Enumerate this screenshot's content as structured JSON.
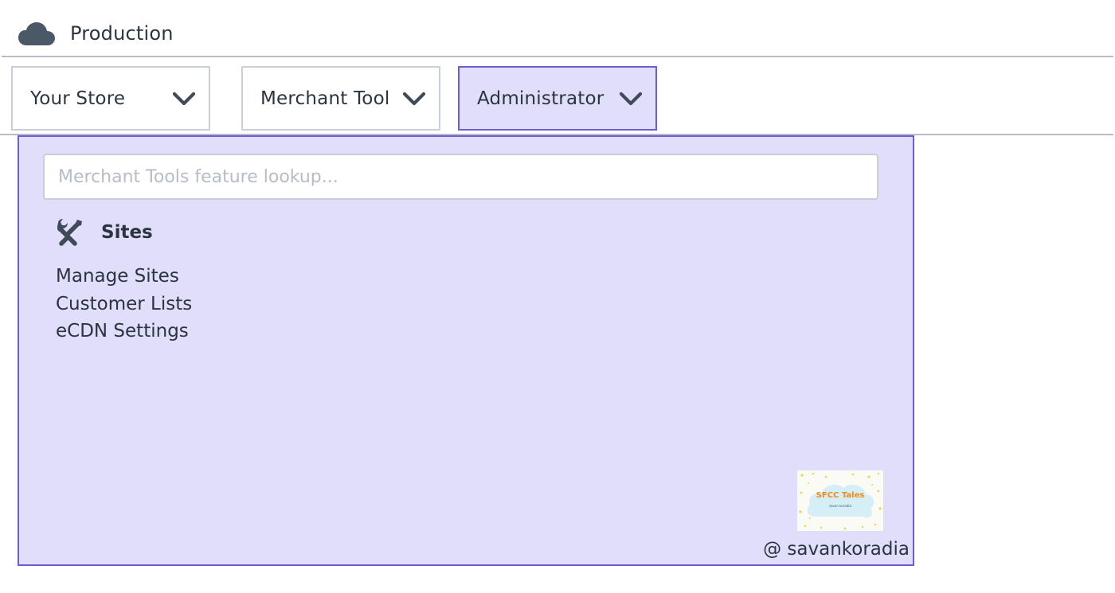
{
  "header": {
    "env_title": "Production",
    "env_icon": "cloud-icon"
  },
  "menus": [
    {
      "label": "Your Store",
      "icon": "chevron-down-icon",
      "active": false
    },
    {
      "label": "Merchant Tool",
      "icon": "chevron-down-icon",
      "active": false
    },
    {
      "label": "Administrator",
      "icon": "chevron-down-icon",
      "active": true
    }
  ],
  "dropdown": {
    "search": {
      "placeholder": "Merchant Tools feature lookup...",
      "value": ""
    },
    "section": {
      "title": "Sites",
      "icon": "tools-icon"
    },
    "items": [
      "Manage Sites",
      "Customer Lists",
      "eCDN Settings"
    ],
    "logo": {
      "text": "SFCC Tales",
      "subtext": "savan koradia"
    },
    "credit": "@ savankoradia"
  },
  "colors": {
    "active_bg": "#e0defa",
    "active_border": "#6c5cd6",
    "text": "#2b3440",
    "divider": "#b6bdc6",
    "placeholder": "#b7bdc6",
    "logo_text": "#f08a1c"
  }
}
